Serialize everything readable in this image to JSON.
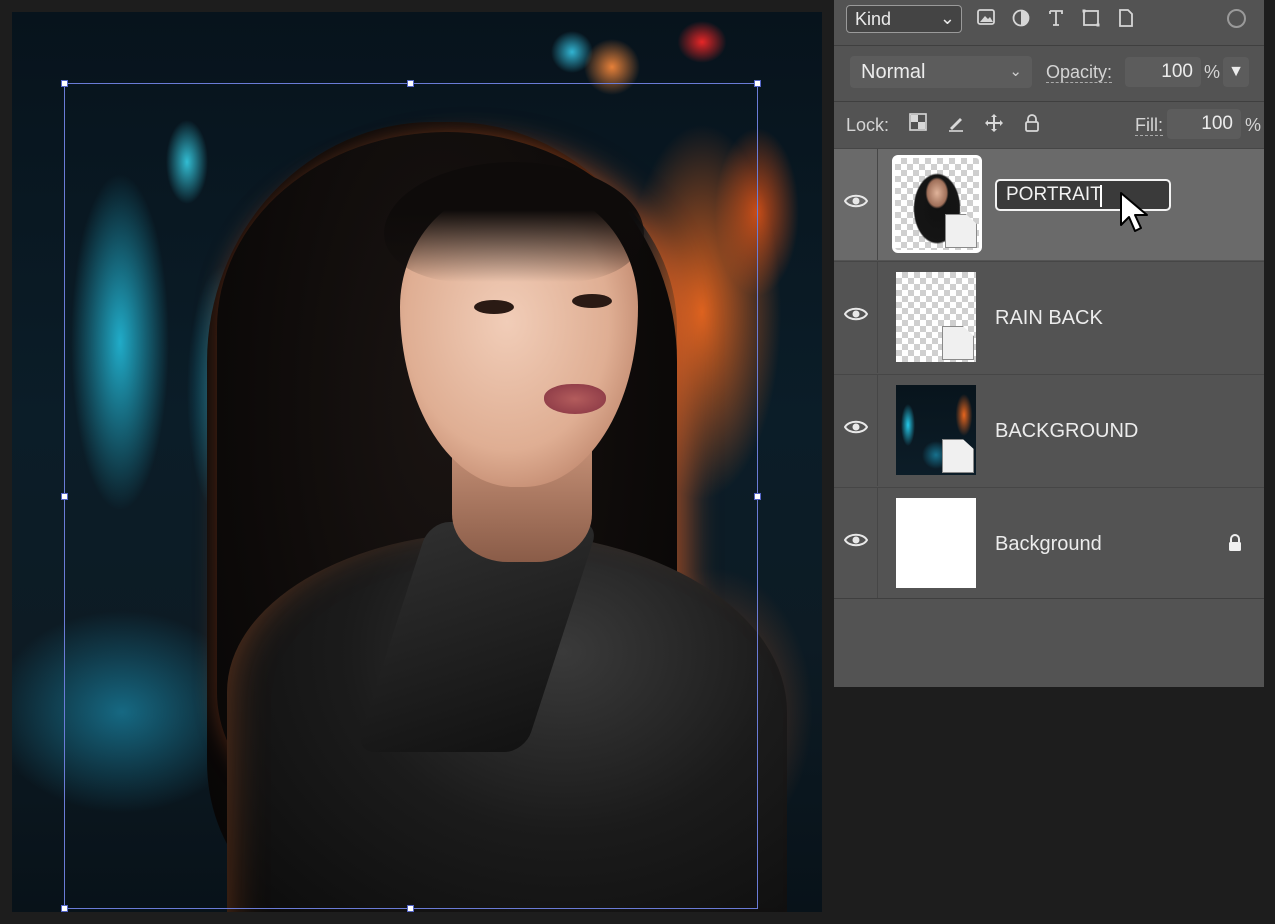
{
  "canvas": {
    "image_alt": "Portrait photo of a woman in a neon-lit rainy alley"
  },
  "layers_panel": {
    "filter": {
      "kind_label": "Kind",
      "icons": [
        "image-filter-icon",
        "adjustment-filter-icon",
        "type-filter-icon",
        "shape-filter-icon",
        "smart-object-filter-icon"
      ]
    },
    "blend_mode": "Normal",
    "opacity_label": "Opacity:",
    "opacity_value": "100",
    "opacity_unit": "%",
    "lock_label": "Lock:",
    "fill_label": "Fill:",
    "fill_value": "100",
    "fill_unit": "%",
    "layers": [
      {
        "name": "PORTRAIT",
        "editing": true,
        "visible": true
      },
      {
        "name": "RAIN BACK",
        "visible": true
      },
      {
        "name": "BACKGROUND",
        "visible": true
      },
      {
        "name": "Background",
        "visible": true,
        "locked": true
      }
    ]
  },
  "colors": {
    "panel_bg": "#535353",
    "selected_row": "#6a6a6a",
    "transform_box": "#6a7bd6"
  }
}
